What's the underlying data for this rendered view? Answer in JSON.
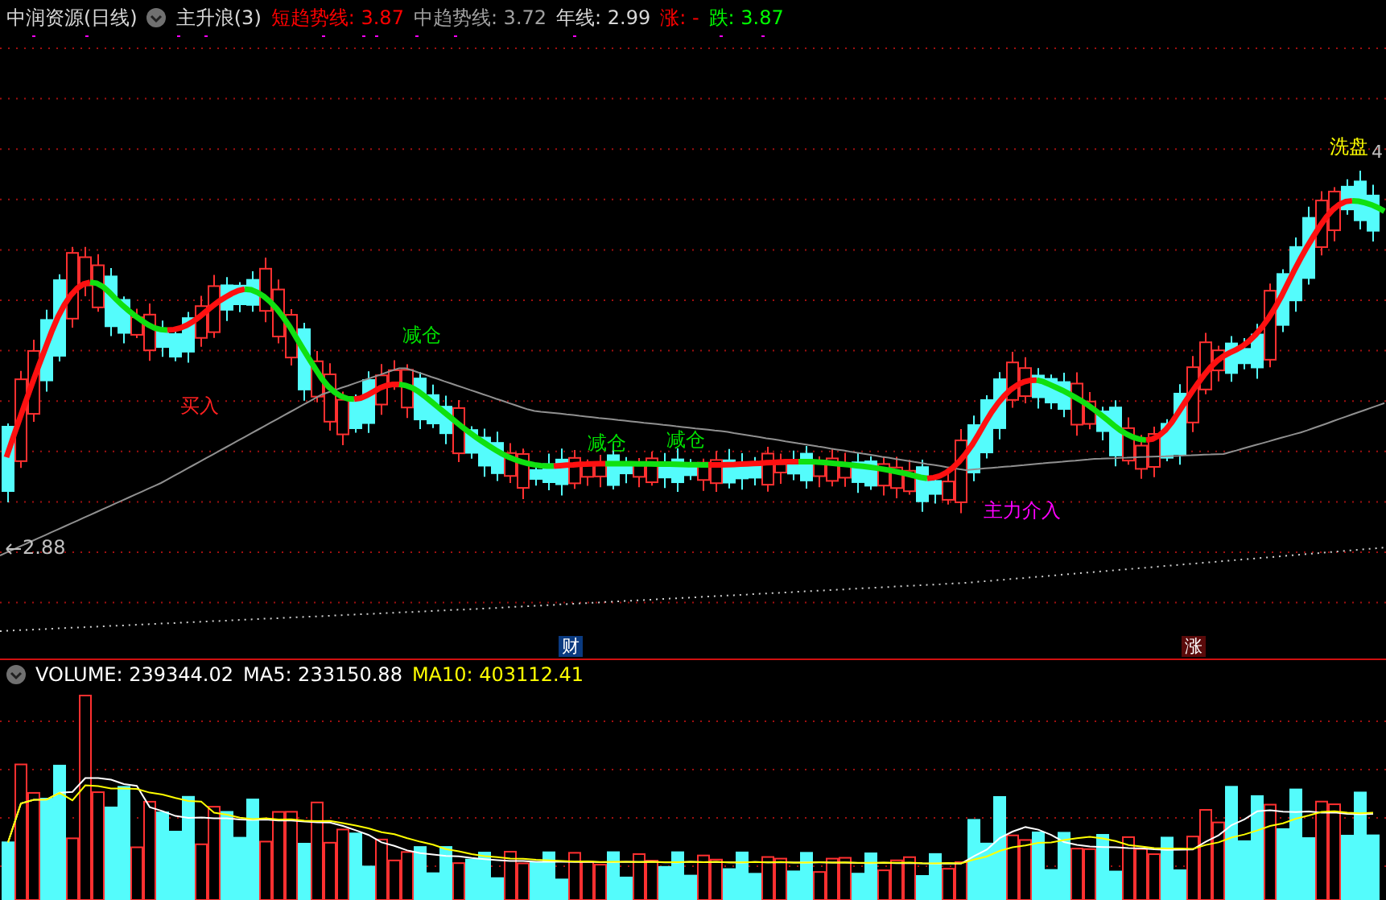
{
  "header": {
    "title": "中润资源(日线)",
    "indicator": "主升浪(3)",
    "legend": [
      {
        "text": "短趋势线: 3.87",
        "color": "#ff0000"
      },
      {
        "text": "中趋势线: 3.72",
        "color": "#a0a0a0"
      },
      {
        "text": "年线: 2.99",
        "color": "#d8d8d8"
      },
      {
        "text": "涨: -",
        "color": "#ff0000"
      },
      {
        "text": "跌: 3.87",
        "color": "#00ff00"
      }
    ]
  },
  "main_chart": {
    "signals": [
      {
        "text": "买入",
        "color": "#ff2020"
      },
      {
        "text": "减仓",
        "color": "#00e000"
      },
      {
        "text": "减仓",
        "color": "#00e000"
      },
      {
        "text": "减仓",
        "color": "#00e000"
      },
      {
        "text": "主力介入",
        "color": "#ff00ff"
      },
      {
        "text": "洗盘",
        "color": "#ffff00"
      }
    ],
    "low_price": "2.88",
    "high_price": "4",
    "event_markers": [
      {
        "text": "财",
        "kind": "finance"
      },
      {
        "text": "涨",
        "kind": "limit"
      }
    ]
  },
  "volume_panel": {
    "legend": [
      {
        "text": "VOLUME: 239344.02",
        "color": "#ffffff"
      },
      {
        "text": "MA5: 233150.88",
        "color": "#ffffff"
      },
      {
        "text": "MA10: 403112.41",
        "color": "#ffff00"
      }
    ]
  }
}
